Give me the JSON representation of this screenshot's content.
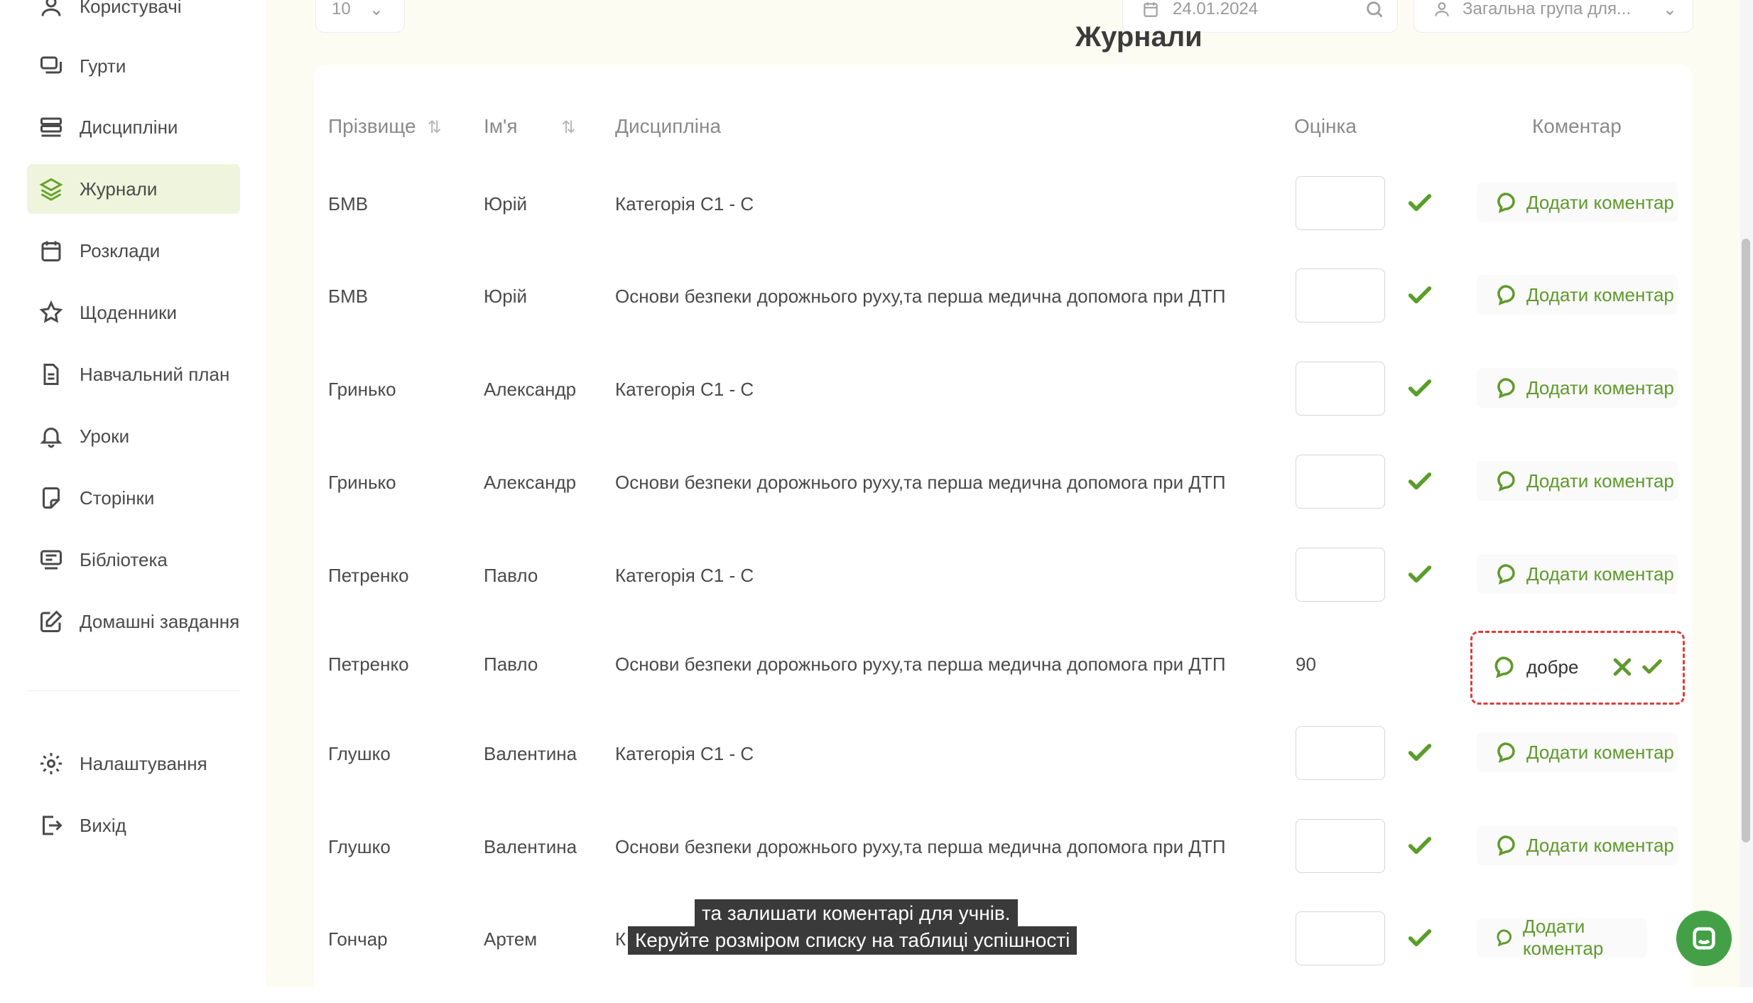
{
  "sidebar": {
    "items": [
      {
        "label": "Користувачі",
        "icon": "user-icon",
        "active": false
      },
      {
        "label": "Гурти",
        "icon": "groups-icon",
        "active": false
      },
      {
        "label": "Дисципліни",
        "icon": "disciplines-icon",
        "active": false
      },
      {
        "label": "Журнали",
        "icon": "layers-icon",
        "active": true
      },
      {
        "label": "Розклади",
        "icon": "calendar-icon",
        "active": false
      },
      {
        "label": "Щоденники",
        "icon": "star-icon",
        "active": false
      },
      {
        "label": "Навчальний план",
        "icon": "document-icon",
        "active": false
      },
      {
        "label": "Уроки",
        "icon": "bell-icon",
        "active": false
      },
      {
        "label": "Сторінки",
        "icon": "page-icon",
        "active": false
      },
      {
        "label": "Бібліотека",
        "icon": "library-icon",
        "active": false
      },
      {
        "label": "Домашні завдання",
        "icon": "edit-icon",
        "active": false
      }
    ],
    "bottom_items": [
      {
        "label": "Налаштування",
        "icon": "gear-icon"
      },
      {
        "label": "Вихід",
        "icon": "logout-icon"
      }
    ]
  },
  "topbar": {
    "page_size": "10",
    "date": "24.01.2024",
    "group_select": "Загальна група для..."
  },
  "page_title": "Журнали",
  "table": {
    "columns": {
      "surname": "Прізвище",
      "name": "Ім'я",
      "discipline": "Дисципліна",
      "grade": "Оцінка",
      "comment": "Коментар"
    },
    "add_comment_label": "Додати коментар",
    "rows": [
      {
        "surname": "БМВ",
        "name": "Юрій",
        "discipline": "Категорія С1 - С",
        "grade": "",
        "editing": false
      },
      {
        "surname": "БМВ",
        "name": "Юрій",
        "discipline": "Основи безпеки дорожнього руху,та перша медична допомога при ДТП",
        "grade": "",
        "editing": false
      },
      {
        "surname": "Гринько",
        "name": "Александр",
        "discipline": "Категорія С1 - С",
        "grade": "",
        "editing": false
      },
      {
        "surname": "Гринько",
        "name": "Александр",
        "discipline": "Основи безпеки дорожнього руху,та перша медична допомога при ДТП",
        "grade": "",
        "editing": false
      },
      {
        "surname": "Петренко",
        "name": "Павло",
        "discipline": "Категорія С1 - С",
        "grade": "",
        "editing": false
      },
      {
        "surname": "Петренко",
        "name": "Павло",
        "discipline": "Основи безпеки дорожнього руху,та перша медична допомога при ДТП",
        "grade": "90",
        "editing": true,
        "comment_value": "добре"
      },
      {
        "surname": "Глушко",
        "name": "Валентина",
        "discipline": "Категорія С1 - С",
        "grade": "",
        "editing": false
      },
      {
        "surname": "Глушко",
        "name": "Валентина",
        "discipline": "Основи безпеки дорожнього руху,та перша медична допомога при ДТП",
        "grade": "",
        "editing": false
      },
      {
        "surname": "Гончар",
        "name": "Артем",
        "discipline": "К",
        "grade": "",
        "editing": false
      }
    ]
  },
  "subtitles": {
    "line1": "та залишати коментарі для учнів.",
    "line2": "Керуйте розміром списку на таблиці успішності"
  }
}
